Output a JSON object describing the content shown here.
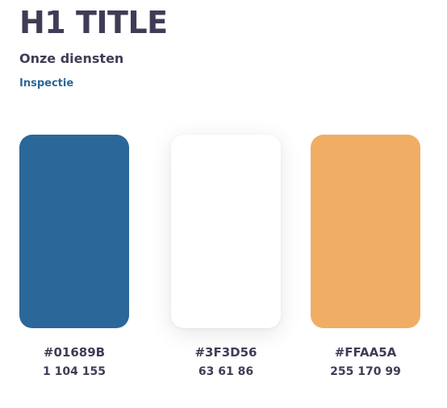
{
  "header": {
    "title": "H1 TITLE",
    "subtitle": "Onze diensten",
    "link": "Inspectie"
  },
  "swatches": [
    {
      "name": "blue",
      "color": "#2b6799",
      "hex": "#01689B",
      "rgb": "1 104 155"
    },
    {
      "name": "white",
      "color": "#ffffff",
      "hex": "#3F3D56",
      "rgb": "63 61 86"
    },
    {
      "name": "orange",
      "color": "#f0ae65",
      "hex": "#FFAA5A",
      "rgb": "255 170 99"
    }
  ],
  "colors": {
    "text": "#3f3d56",
    "link": "#2b6799"
  }
}
